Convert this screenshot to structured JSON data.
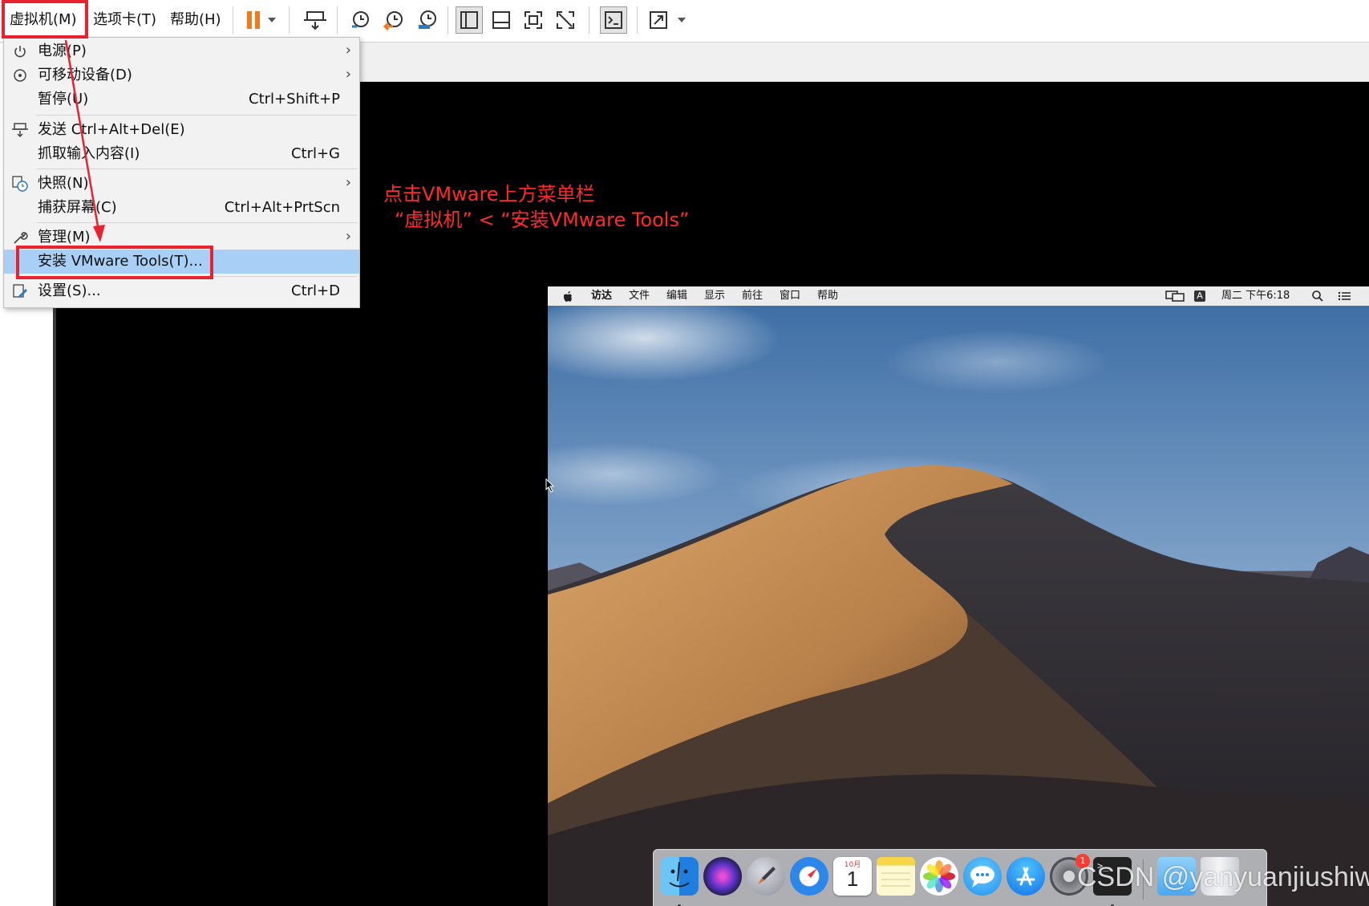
{
  "menubar": {
    "vm_menu": "虚拟机(M)",
    "tabs_menu": "选项卡(T)",
    "help_menu": "帮助(H)"
  },
  "vm_menu_items": {
    "power": {
      "label": "电源(P)"
    },
    "removable": {
      "label": "可移动设备(D)"
    },
    "pause": {
      "label": "暂停(U)",
      "shortcut": "Ctrl+Shift+P"
    },
    "send_cad": {
      "label": "发送 Ctrl+Alt+Del(E)"
    },
    "grab_input": {
      "label": "抓取输入内容(I)",
      "shortcut": "Ctrl+G"
    },
    "snapshot": {
      "label": "快照(N)"
    },
    "capture": {
      "label": "捕获屏幕(C)",
      "shortcut": "Ctrl+Alt+PrtScn"
    },
    "manage": {
      "label": "管理(M)"
    },
    "install_tools": {
      "label": "安装 VMware Tools(T)..."
    },
    "settings": {
      "label": "设置(S)...",
      "shortcut": "Ctrl+D"
    }
  },
  "annotation": {
    "line1": "点击VMware上方菜单栏",
    "line2": "“虚拟机”  <  “安装VMware Tools”"
  },
  "mac_menubar": {
    "items": [
      "访达",
      "文件",
      "编辑",
      "显示",
      "前往",
      "窗口",
      "帮助"
    ],
    "input_badge": "A",
    "clock": "周二 下午6:18"
  },
  "dock": {
    "calendar_month": "10月",
    "calendar_day": "1",
    "prefs_badge": "1",
    "terminal_prompt": ">_"
  },
  "watermark": "CSDN @yanyuanjiushiwo",
  "colors": {
    "highlight": "#a8cff5",
    "annotation_red": "#e8232f",
    "pause_orange": "#f07b1e"
  }
}
